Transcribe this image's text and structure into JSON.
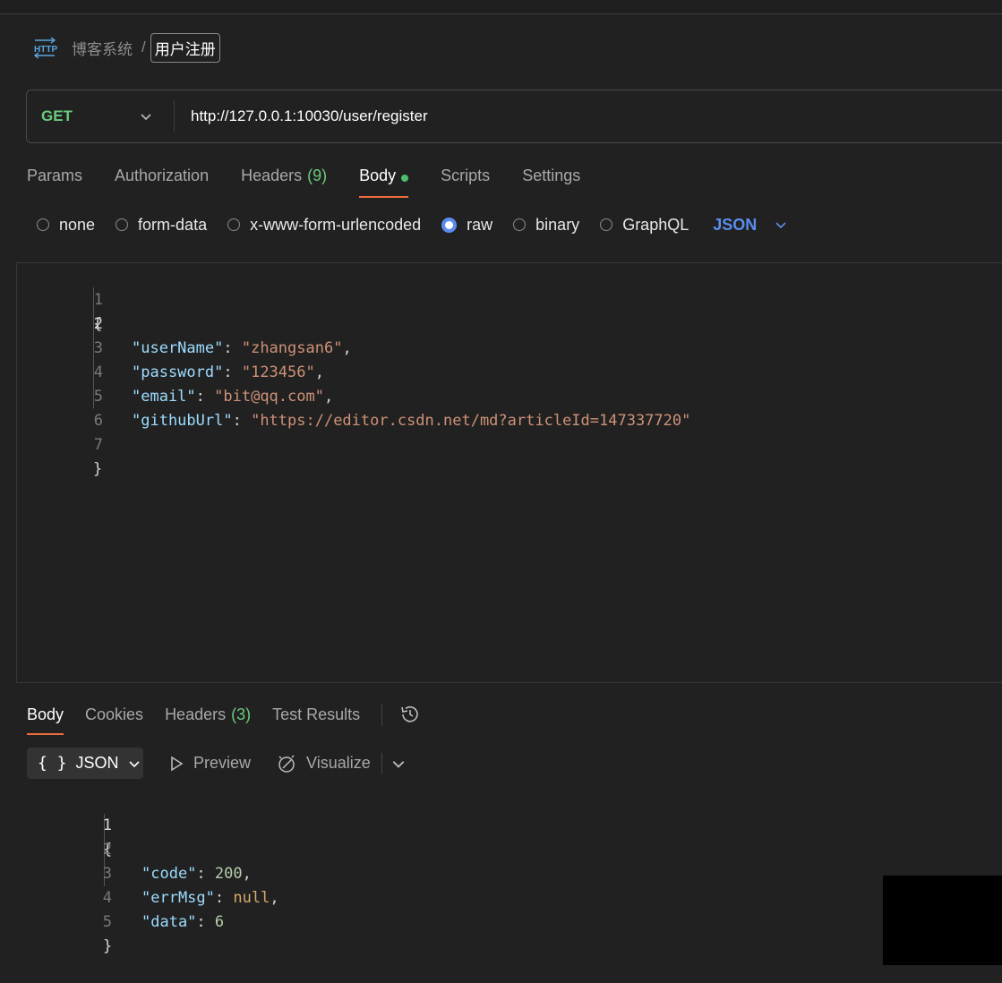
{
  "breadcrumb": {
    "parent": "博客系统",
    "separator": "/",
    "current": "用户注册"
  },
  "request": {
    "method": "GET",
    "url": "http://127.0.0.1:10030/user/register"
  },
  "request_tabs": [
    {
      "label": "Params"
    },
    {
      "label": "Authorization"
    },
    {
      "label": "Headers",
      "count": "(9)"
    },
    {
      "label": "Body",
      "active": true
    },
    {
      "label": "Scripts"
    },
    {
      "label": "Settings"
    }
  ],
  "body_types": {
    "options": [
      "none",
      "form-data",
      "x-www-form-urlencoded",
      "raw",
      "binary",
      "GraphQL"
    ],
    "selected": "raw",
    "language": "JSON"
  },
  "request_body": {
    "line_numbers": [
      "1",
      "2",
      "3",
      "4",
      "5",
      "6",
      "7"
    ],
    "brace_open": "{",
    "brace_close": "}",
    "fields": [
      {
        "key": "\"userName\"",
        "value": "\"zhangsan6\"",
        "comma": ","
      },
      {
        "key": "\"password\"",
        "value": "\"123456\"",
        "comma": ","
      },
      {
        "key": "\"email\"",
        "value": "\"bit@qq.com\"",
        "comma": ","
      },
      {
        "key": "\"githubUrl\"",
        "value": "\"https://editor.csdn.net/md?articleId=147337720\"",
        "comma": ""
      }
    ]
  },
  "response_tabs": [
    {
      "label": "Body",
      "active": true
    },
    {
      "label": "Cookies"
    },
    {
      "label": "Headers",
      "count": "(3)"
    },
    {
      "label": "Test Results"
    }
  ],
  "response_toolbar": {
    "format_braces": "{ }",
    "format": "JSON",
    "preview": "Preview",
    "visualize": "Visualize"
  },
  "response_body": {
    "line_numbers": [
      "1",
      "2",
      "3",
      "4",
      "5"
    ],
    "brace_open": "{",
    "brace_close": "}",
    "fields": [
      {
        "key": "\"code\"",
        "value": "200",
        "comma": ","
      },
      {
        "key": "\"errMsg\"",
        "value": "null",
        "comma": ","
      },
      {
        "key": "\"data\"",
        "value": "6",
        "comma": ""
      }
    ]
  },
  "colors": {
    "accent_tab": "#ef6c3c",
    "method_get": "#6bc97d",
    "link_blue": "#5b8def",
    "json_key": "#9cdcfe",
    "json_string": "#ce9178",
    "json_number": "#b5cea8"
  }
}
